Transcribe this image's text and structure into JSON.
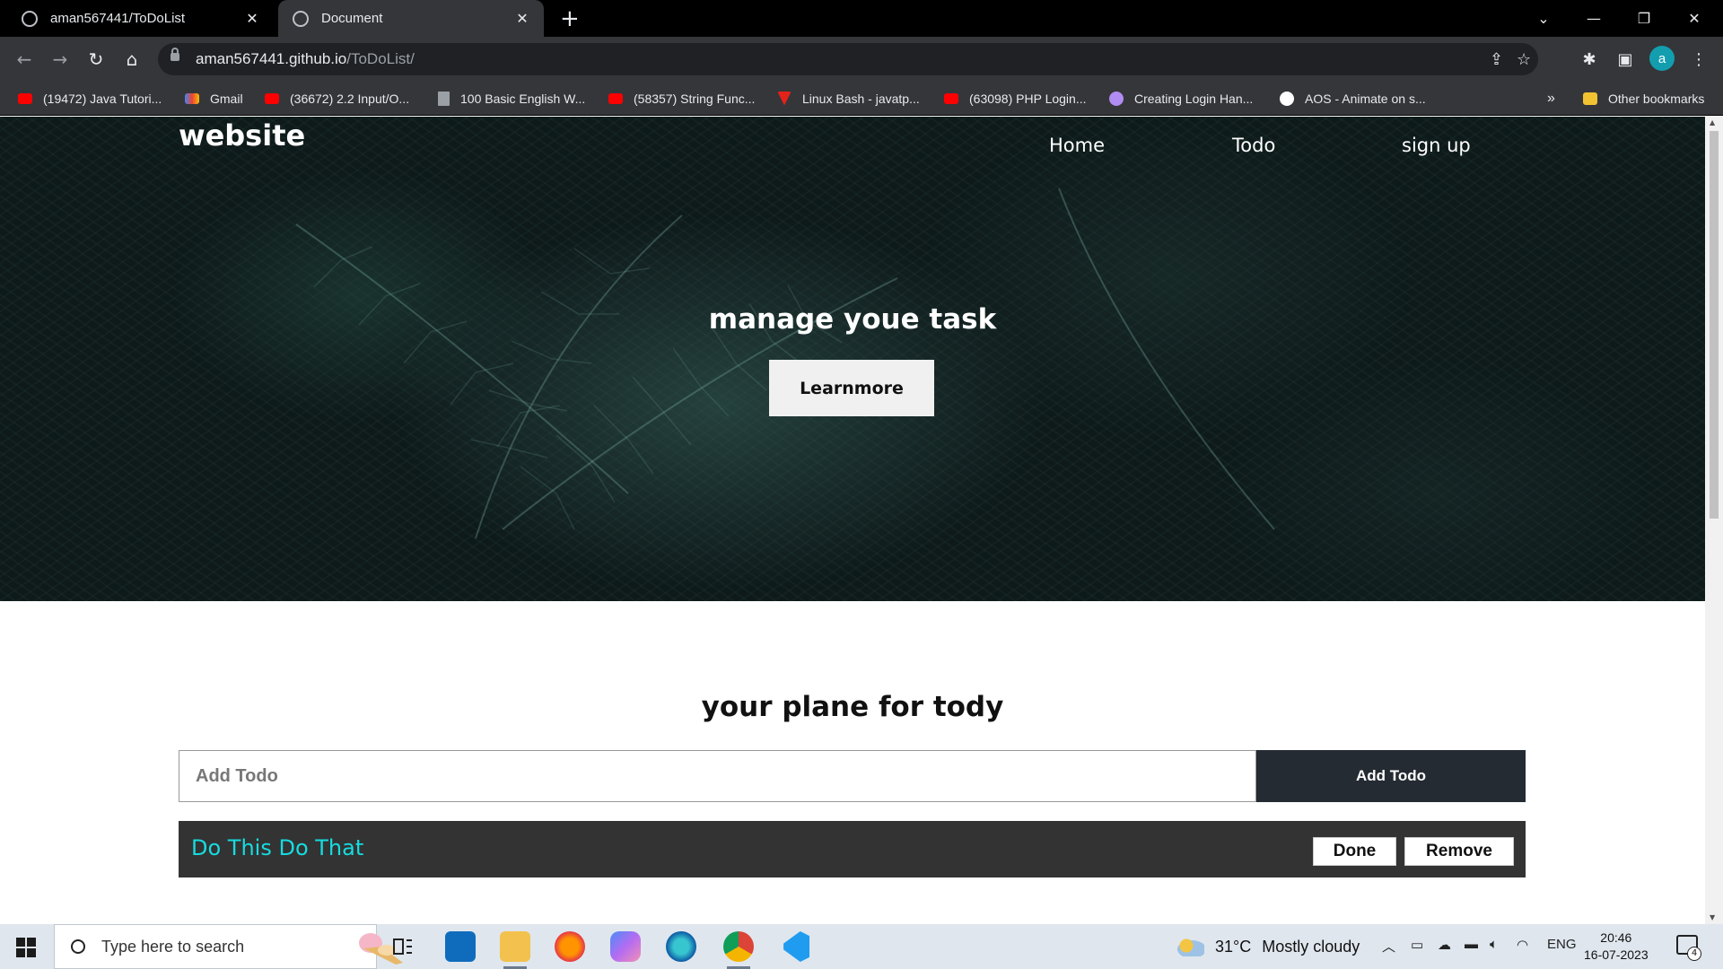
{
  "browser": {
    "tabs": [
      {
        "title": "aman567441/ToDoList",
        "icon": "github-icon"
      },
      {
        "title": "Document",
        "icon": "globe-icon"
      }
    ],
    "url": {
      "host": "aman567441.github.io",
      "path": "/ToDoList/"
    },
    "profile_initial": "a",
    "bookmarks": [
      {
        "label": "(19472) Java Tutori...",
        "icon": "youtube-icon"
      },
      {
        "label": "Gmail",
        "icon": "gmail-icon"
      },
      {
        "label": "(36672) 2.2 Input/O...",
        "icon": "youtube-icon"
      },
      {
        "label": "100 Basic English W...",
        "icon": "document-icon"
      },
      {
        "label": "(58357) String Func...",
        "icon": "youtube-icon"
      },
      {
        "label": "Linux Bash - javatp...",
        "icon": "javatpoint-icon"
      },
      {
        "label": "(63098) PHP Login...",
        "icon": "youtube-icon"
      },
      {
        "label": "Creating Login Han...",
        "icon": "profile-icon"
      },
      {
        "label": "AOS - Animate on s...",
        "icon": "globe-icon"
      }
    ],
    "bookmarks_overflow": "»",
    "other_bookmarks": "Other bookmarks"
  },
  "site": {
    "logo": "website",
    "nav": [
      "Home",
      "Todo",
      "sign up"
    ],
    "hero_title": "manage youe task",
    "hero_button": "Learnmore",
    "plan_title": "your plane for tody",
    "input_placeholder": "Add Todo",
    "add_button": "Add Todo",
    "todos": [
      {
        "text": "Do This Do That",
        "done_label": "Done",
        "remove_label": "Remove"
      }
    ],
    "colors": {
      "todo_text": "#16dce0",
      "todo_row": "#333333",
      "add_button": "#252b33"
    }
  },
  "taskbar": {
    "search_placeholder": "Type here to search",
    "apps": [
      "task-view-icon",
      "mail-icon",
      "file-explorer-icon",
      "firefox-icon",
      "copilot-icon",
      "edge-icon",
      "chrome-icon",
      "vscode-icon"
    ],
    "weather": {
      "temp": "31°C",
      "condition": "Mostly cloudy"
    },
    "language": "ENG",
    "time": "20:46",
    "date": "16-07-2023",
    "notifications": "4"
  }
}
